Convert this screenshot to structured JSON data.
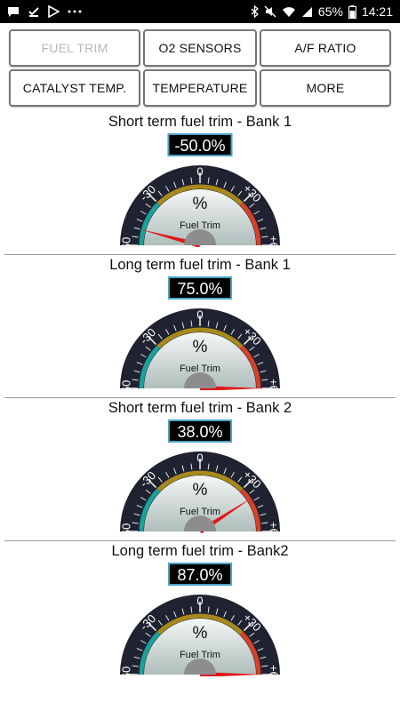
{
  "status_bar": {
    "icons_left": [
      "message-icon",
      "download-done-icon",
      "play-store-icon",
      "more-dots-icon"
    ],
    "battery": "65%",
    "time": "14:21"
  },
  "tabs": [
    {
      "label": "FUEL TRIM",
      "active": true
    },
    {
      "label": "O2 SENSORS",
      "active": false
    },
    {
      "label": "A/F RATIO",
      "active": false
    },
    {
      "label": "CATALYST TEMP.",
      "active": false
    },
    {
      "label": "TEMPERATURE",
      "active": false
    },
    {
      "label": "MORE",
      "active": false
    }
  ],
  "gauges": [
    {
      "title": "Short term fuel trim - Bank 1",
      "readout": "-50.0%",
      "value": -50.0,
      "unit": "%",
      "caption": "Fuel Trim"
    },
    {
      "title": "Long term fuel trim - Bank 1",
      "readout": "75.0%",
      "value": 75.0,
      "unit": "%",
      "caption": "Fuel Trim"
    },
    {
      "title": "Short term fuel trim - Bank 2",
      "readout": "38.0%",
      "value": 38.0,
      "unit": "%",
      "caption": "Fuel Trim"
    },
    {
      "title": "Long term fuel trim - Bank2",
      "readout": "87.0%",
      "value": 87.0,
      "unit": "%",
      "caption": "Fuel Trim"
    }
  ],
  "gauge_scale": {
    "min": -60,
    "max": 60,
    "tick_labels": [
      "-60",
      "-30",
      "0",
      "+30",
      "+60"
    ],
    "zones": [
      {
        "from": -60,
        "to": -30,
        "color": "#1aa19a"
      },
      {
        "from": -30,
        "to": 30,
        "color": "#a8891c"
      },
      {
        "from": 30,
        "to": 60,
        "color": "#d8402a"
      }
    ]
  }
}
